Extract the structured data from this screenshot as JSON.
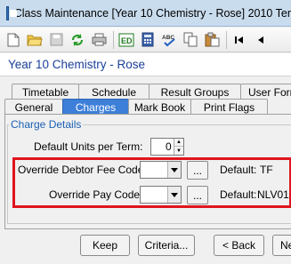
{
  "window": {
    "title": "Class Maintenance  [Year 10 Chemistry - Rose]  2010 Ter"
  },
  "header": {
    "class_title": "Year 10 Chemistry - Rose"
  },
  "toolbar": {
    "icons": [
      "new-document-icon",
      "open-folder-icon",
      "save-icon",
      "refresh-icon",
      "print-icon",
      "edit-icon",
      "calculator-icon",
      "spell-check-icon",
      "copy-icon",
      "paste-icon",
      "first-record-icon",
      "previous-record-icon"
    ]
  },
  "tabs": {
    "top": [
      "Timetable",
      "Schedule",
      "Result Groups",
      "User Forr"
    ],
    "bottom": [
      "General",
      "Charges",
      "Mark Book",
      "Print Flags"
    ],
    "active": "Charges"
  },
  "charge_details": {
    "group_label": "Charge Details",
    "units_label": "Default Units per Term:",
    "units_value": "0",
    "debtor_label": "Override Debtor Fee Code:",
    "debtor_value": "",
    "debtor_default_label": "Default:",
    "debtor_default_value": "TF",
    "pay_label": "Override Pay Code:",
    "pay_value": "",
    "pay_default_label": "Default:",
    "pay_default_value": "NLV01",
    "ellipsis": "..."
  },
  "buttons": {
    "keep": "Keep",
    "criteria": "Criteria...",
    "back": "< Back",
    "next": "Ne"
  },
  "colors": {
    "highlight": "#e0141e",
    "active_tab": "#3d7fd9",
    "class_title": "#1a3f9a",
    "group_label": "#1a5fb4"
  }
}
